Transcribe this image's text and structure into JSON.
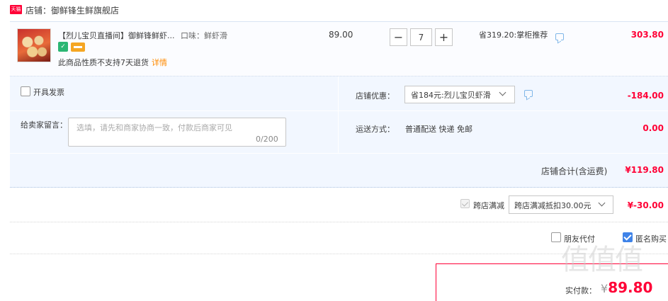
{
  "shop": {
    "badge": "天猫",
    "label": "店铺：御鲜锋生鲜旗舰店"
  },
  "item": {
    "title": "【烈儿宝贝直播间】御鲜锋鲜虾...",
    "attribute": "口味：鲜虾滑",
    "return_note": "此商品性质不支持7天退货",
    "return_detail_link": "详情",
    "unit_price": "89.00",
    "quantity": "7",
    "saving": "省319.20:掌柜推荐",
    "total": "303.80"
  },
  "options": {
    "invoice_label": "开具发票",
    "message_label": "给卖家留言：",
    "message_placeholder": "选填，请先和商家协商一致，付款后商家可见",
    "message_count": "0/200",
    "coupon_label": "店铺优惠：",
    "coupon_value": "省184元:烈儿宝贝虾滑",
    "coupon_amount": "-184.00",
    "shipping_label": "运送方式：",
    "shipping_value": "普通配送 快递 免邮",
    "shipping_amount": "0.00"
  },
  "store_total": {
    "label": "店铺合计(含运费)",
    "value": "¥119.80"
  },
  "cross_store": {
    "label": "跨店满减",
    "select_value": "跨店满减抵扣30.00元",
    "amount": "¥-30.00"
  },
  "pay_options": {
    "friend_label": "朋友代付",
    "anonymous_label": "匿名购买",
    "anonymous_checked": true
  },
  "pay": {
    "label": "实付款：",
    "currency": "¥",
    "amount": "89.80"
  },
  "watermark": "值值值",
  "colors": {
    "accent_red": "#ff0036",
    "panel_blue": "#f2f7ff",
    "check_blue": "#3f83e8"
  }
}
